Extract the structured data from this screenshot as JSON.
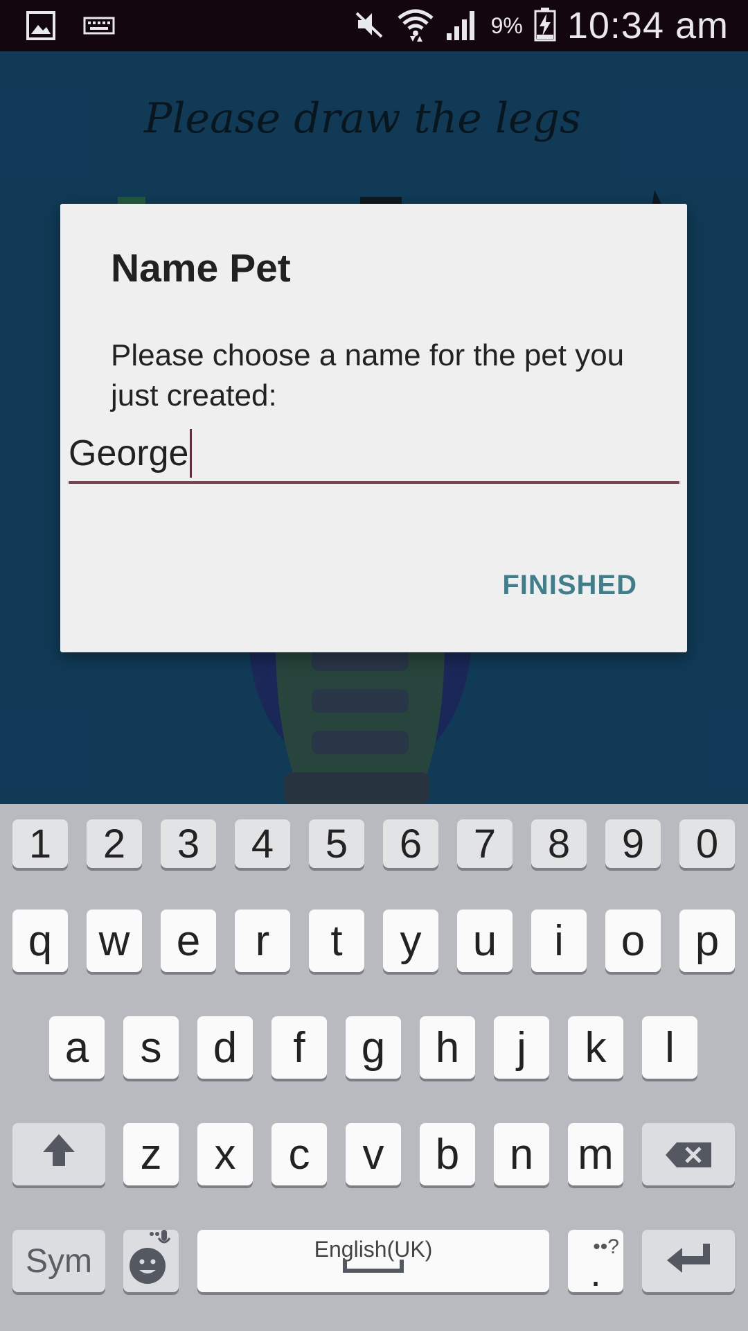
{
  "status_bar": {
    "battery_pct": "9%",
    "time": "10:34 am"
  },
  "app": {
    "prompt": "Please draw the legs"
  },
  "dialog": {
    "title": "Name Pet",
    "message": "Please choose a name for the pet you just created:",
    "input_value": "George",
    "finish_label": "FINISHED"
  },
  "keyboard": {
    "row_numbers": [
      "1",
      "2",
      "3",
      "4",
      "5",
      "6",
      "7",
      "8",
      "9",
      "0"
    ],
    "row_top": [
      "q",
      "w",
      "e",
      "r",
      "t",
      "y",
      "u",
      "i",
      "o",
      "p"
    ],
    "row_mid": [
      "a",
      "s",
      "d",
      "f",
      "g",
      "h",
      "j",
      "k",
      "l"
    ],
    "row_bottom": [
      "z",
      "x",
      "c",
      "v",
      "b",
      "n",
      "m"
    ],
    "sym_label": "Sym",
    "space_label": "English(UK)",
    "period_label": ".",
    "period_extra": "••?"
  },
  "colors": {
    "app_background": "#14476a",
    "accent_button": "#3f7f8c",
    "status_bar": "#14060f"
  }
}
